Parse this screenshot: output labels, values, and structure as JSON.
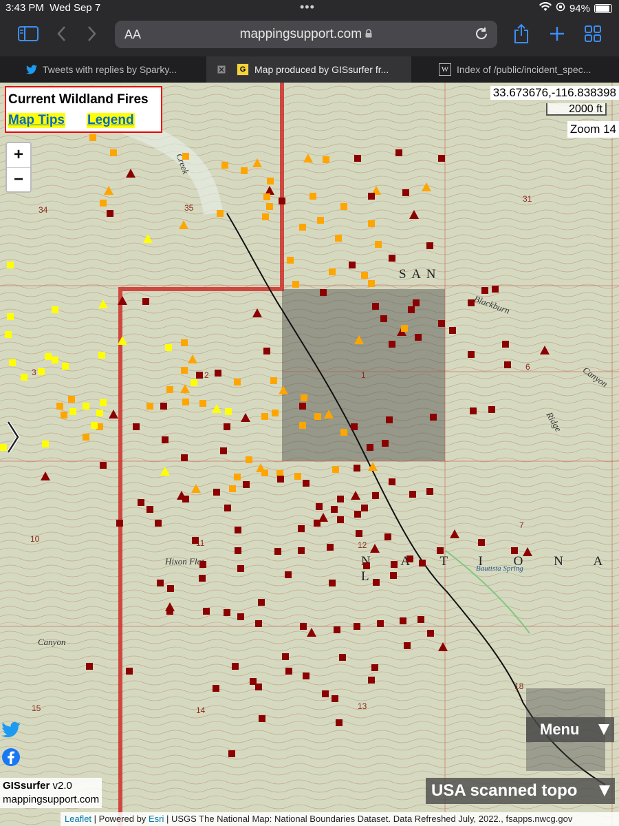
{
  "status": {
    "time": "3:43 PM",
    "date": "Wed Sep 7",
    "battery": "94%"
  },
  "browser": {
    "url": "mappingsupport.com",
    "aa_label": "AA",
    "tabs": [
      {
        "label": "Tweets with replies by Sparky...",
        "icon": "twitter-icon",
        "active": false
      },
      {
        "label": "Map produced by GISsurfer fr...",
        "icon": "gissurfer-icon",
        "active": true
      },
      {
        "label": "Index of /public/incident_spec...",
        "icon": "wikipedia-icon",
        "active": false
      }
    ]
  },
  "map": {
    "title": "Current Wildland Fires",
    "map_tips": "Map Tips",
    "legend": "Legend",
    "coords": "33.673676,-116.838398",
    "scale": "2000 ft",
    "zoom": "Zoom 14",
    "menu": "Menu",
    "basemap": "USA scanned topo",
    "brand_name": "GISsurfer",
    "brand_version": "v2.0",
    "brand_site": "mappingsupport.com",
    "attribution": {
      "leaflet": "Leaflet",
      "powered": "| Powered by",
      "esri": "Esri",
      "rest": "| USGS The National Map: National Boundaries Dataset. Data Refreshed July, 2022., fsapps.nwcg.gov"
    },
    "labels": {
      "san": "S A N",
      "national": "N A T I O N A L",
      "hixon_flat": "Hixon Flat",
      "canyon1": "Canyon",
      "canyon2": "Canyon",
      "blackburn": "Blackburn",
      "ridge": "Ridge",
      "creek": "Creek",
      "bautista_spring": "Bautista Spring",
      "sec34": "34",
      "sec35": "35",
      "sec31": "31",
      "sec3": "3",
      "sec2": "2",
      "sec1": "1",
      "sec6": "6",
      "sec10": "10",
      "sec11": "11",
      "sec12": "12",
      "sec7": "7",
      "sec15": "15",
      "sec14": "14",
      "sec13": "13",
      "sec18": "18"
    },
    "colors": {
      "red": "#8b0000",
      "orange": "#ffa500",
      "yellow": "#ffff00",
      "boundary": "#d0322d"
    }
  }
}
